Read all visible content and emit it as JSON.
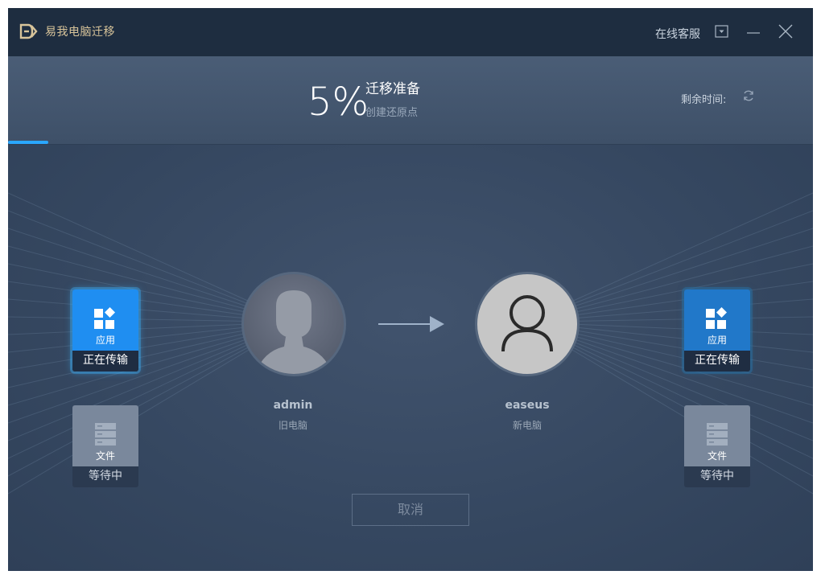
{
  "titlebar": {
    "app_title": "易我电脑迁移",
    "online_service": "在线客服",
    "icons": [
      "logo-icon",
      "dropdown-icon",
      "minimize-icon",
      "close-icon"
    ]
  },
  "progress": {
    "percent_text": "5%",
    "percent_value": 5,
    "stage_title": "迁移准备",
    "stage_sub": "创建还原点",
    "remaining_label": "剩余时间:"
  },
  "source": {
    "name": "admin",
    "role": "旧电脑",
    "apps_tile": {
      "label": "应用",
      "status": "正在传输"
    },
    "files_tile": {
      "label": "文件",
      "status": "等待中"
    }
  },
  "target": {
    "name": "easeus",
    "role": "新电脑",
    "apps_tile": {
      "label": "应用",
      "status": "正在传输"
    },
    "files_tile": {
      "label": "文件",
      "status": "等待中"
    }
  },
  "actions": {
    "cancel_label": "取消"
  },
  "colors": {
    "accent": "#2aa7ff",
    "tile_active": "#1f8ef1",
    "background": "#34465f",
    "titlebar": "#1e2d40",
    "brand_gold": "#d8c49a"
  }
}
